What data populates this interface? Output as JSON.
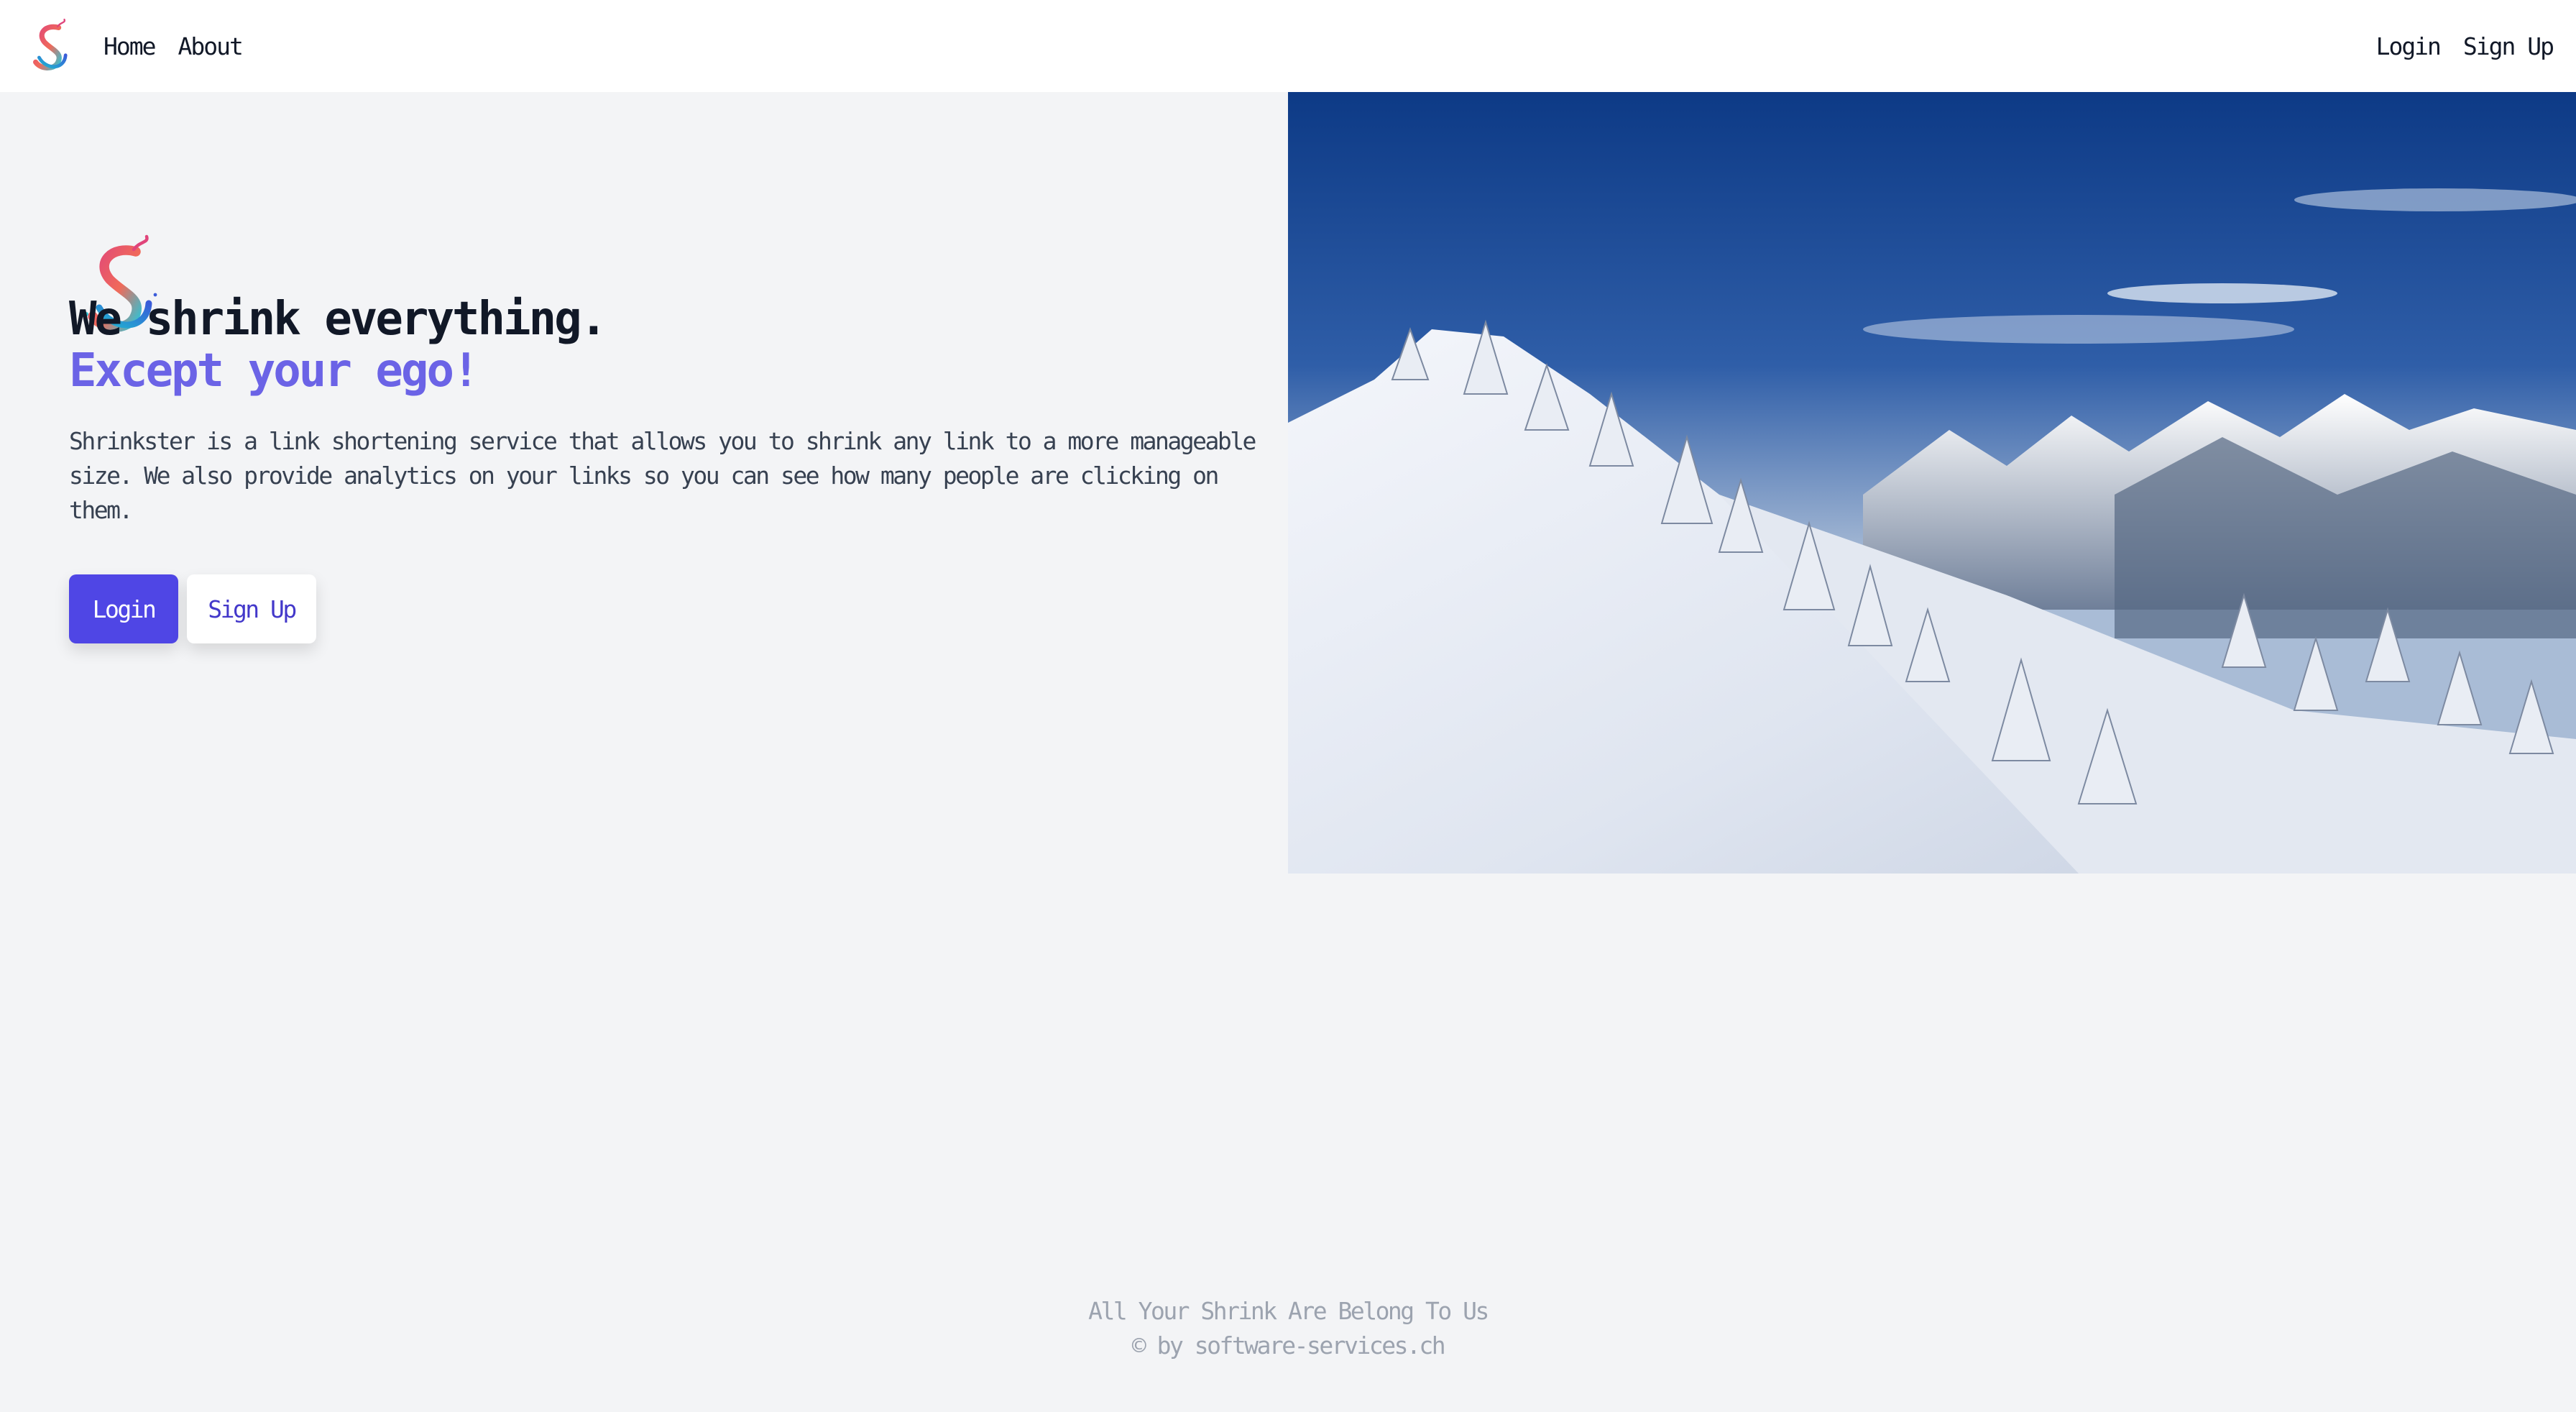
{
  "nav": {
    "logo_icon": "shrinkster-logo-icon",
    "links": [
      {
        "label": "Home"
      },
      {
        "label": "About"
      }
    ],
    "auth": {
      "login": "Login",
      "signup": "Sign Up"
    }
  },
  "hero": {
    "logo_icon": "shrinkster-logo-icon",
    "title_line1": "We shrink everything.",
    "title_line2": "Except your ego!",
    "description": "Shrinkster is a link shortening service that allows you to shrink any link to a more manageable size. We also provide analytics on your links so you can see how many people are clicking on them.",
    "login_button": "Login",
    "signup_button": "Sign Up",
    "image_icon": "snowy-mountain-image"
  },
  "footer": {
    "tagline": "All Your Shrink Are Belong To Us",
    "copyright": "© by software-services.ch"
  },
  "colors": {
    "accent": "#4f46e5",
    "title_accent": "#6b63e6",
    "background": "#f3f4f6",
    "footer_text": "#9ca3af"
  }
}
